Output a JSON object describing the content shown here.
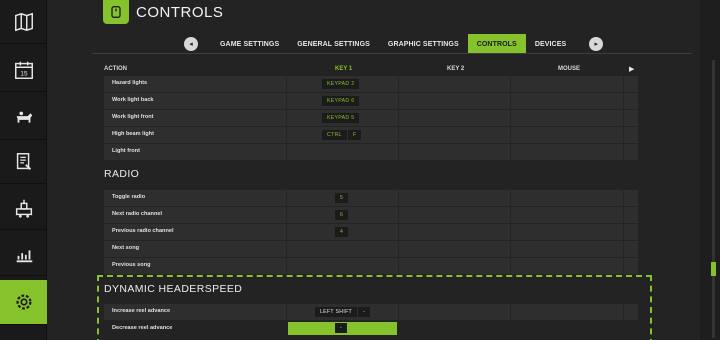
{
  "app": {
    "title": "CONTROLS"
  },
  "sidebar": {
    "items": [
      {
        "name": "map-icon"
      },
      {
        "name": "calendar-icon"
      },
      {
        "name": "animals-icon"
      },
      {
        "name": "contracts-icon"
      },
      {
        "name": "production-icon"
      },
      {
        "name": "statistics-icon"
      },
      {
        "name": "settings-icon"
      }
    ]
  },
  "tabs": {
    "prev": "◂",
    "next": "▸",
    "items": [
      {
        "label": "GAME SETTINGS"
      },
      {
        "label": "GENERAL SETTINGS"
      },
      {
        "label": "GRAPHIC SETTINGS"
      },
      {
        "label": "CONTROLS"
      },
      {
        "label": "DEVICES"
      }
    ]
  },
  "table": {
    "headers": {
      "action": "ACTION",
      "key1": "KEY 1",
      "key2": "KEY 2",
      "mouse": "MOUSE",
      "play": "▶"
    }
  },
  "vehicle_rows": [
    {
      "action": "Hazard lights",
      "keys": [
        "KEYPAD 2"
      ]
    },
    {
      "action": "Work light back",
      "keys": [
        "KEYPAD 6"
      ]
    },
    {
      "action": "Work light front",
      "keys": [
        "KEYPAD 5"
      ]
    },
    {
      "action": "High beam light",
      "keys": [
        "CTRL",
        "F"
      ]
    },
    {
      "action": "Light front",
      "keys": []
    }
  ],
  "radio": {
    "title": "RADIO",
    "rows": [
      {
        "action": "Toggle radio",
        "keys": [
          "5"
        ]
      },
      {
        "action": "Next radio channel",
        "keys": [
          "6"
        ]
      },
      {
        "action": "Previous radio channel",
        "keys": [
          "4"
        ]
      },
      {
        "action": "Next song",
        "keys": []
      },
      {
        "action": "Previous song",
        "keys": []
      }
    ]
  },
  "headerspeed": {
    "title": "DYNAMIC HEADERSPEED",
    "rows": [
      {
        "action": "Increase reel advance",
        "keys": [
          "LEFT SHIFT",
          "-"
        ]
      },
      {
        "action": "Decrease reel advance",
        "keys": [
          "-"
        ]
      }
    ]
  },
  "colors": {
    "accent": "#86c22b",
    "background": "#232323",
    "row": "#2e2e2e"
  }
}
